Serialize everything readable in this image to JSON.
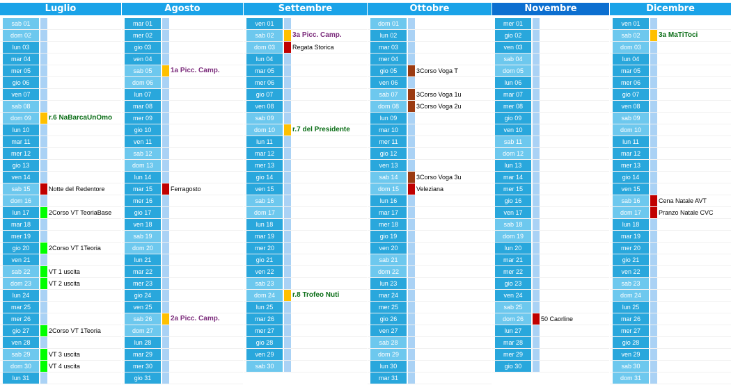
{
  "colors": {
    "header": "#1aa3e8",
    "header_dark": "#0c6fd0",
    "weekday": "#29a7dc",
    "weekend": "#6dc8ee",
    "marker": "#aad2f5",
    "yellow": "#ffc000",
    "red": "#c00000",
    "brown": "#9b3b12",
    "green": "#00ff00"
  },
  "months": [
    {
      "name": "Luglio",
      "header": "light",
      "days": [
        {
          "d": "sab 01",
          "w": true
        },
        {
          "d": "dom 02",
          "w": true
        },
        {
          "d": "lun 03"
        },
        {
          "d": "mar 04"
        },
        {
          "d": "mer 05"
        },
        {
          "d": "gio 06"
        },
        {
          "d": "ven 07"
        },
        {
          "d": "sab 08",
          "w": true
        },
        {
          "d": "dom 09",
          "w": true,
          "mk": "yellow",
          "ev": "r.6 NaBarcaUnOmo",
          "st": "bold"
        },
        {
          "d": "lun 10"
        },
        {
          "d": "mar 11"
        },
        {
          "d": "mer 12"
        },
        {
          "d": "gio 13"
        },
        {
          "d": "ven 14"
        },
        {
          "d": "sab 15",
          "w": true,
          "mk": "red",
          "ev": "Notte del Redentore",
          "st": "normal"
        },
        {
          "d": "dom 16",
          "w": true
        },
        {
          "d": "lun 17",
          "mk": "green",
          "ev": "2Corso VT TeoriaBase",
          "st": "normal"
        },
        {
          "d": "mar 18"
        },
        {
          "d": "mer 19"
        },
        {
          "d": "gio 20",
          "mk": "green",
          "ev": "2Corso VT 1Teoria",
          "st": "normal"
        },
        {
          "d": "ven 21"
        },
        {
          "d": "sab 22",
          "w": true,
          "mk": "green",
          "ev": "VT 1 uscita",
          "st": "normal"
        },
        {
          "d": "dom 23",
          "w": true,
          "mk": "green",
          "ev": "VT 2 uscita",
          "st": "normal"
        },
        {
          "d": "lun 24"
        },
        {
          "d": "mar 25"
        },
        {
          "d": "mer 26"
        },
        {
          "d": "gio 27",
          "mk": "green",
          "ev": "2Corso VT 1Teoria",
          "st": "normal"
        },
        {
          "d": "ven 28"
        },
        {
          "d": "sab 29",
          "w": true,
          "mk": "green",
          "ev": "VT 3 uscita",
          "st": "normal"
        },
        {
          "d": "dom 30",
          "w": true,
          "mk": "green",
          "ev": "VT 4 uscita",
          "st": "normal"
        },
        {
          "d": "lun 31"
        }
      ]
    },
    {
      "name": "Agosto",
      "header": "light",
      "days": [
        {
          "d": "mar 01"
        },
        {
          "d": "mer 02"
        },
        {
          "d": "gio 03"
        },
        {
          "d": "ven 04"
        },
        {
          "d": "sab 05",
          "w": true,
          "mk": "yellow",
          "ev": "1a Picc. Camp.",
          "st": "purple"
        },
        {
          "d": "dom 06",
          "w": true
        },
        {
          "d": "lun 07"
        },
        {
          "d": "mar 08"
        },
        {
          "d": "mer 09"
        },
        {
          "d": "gio 10"
        },
        {
          "d": "ven 11"
        },
        {
          "d": "sab 12",
          "w": true
        },
        {
          "d": "dom 13",
          "w": true
        },
        {
          "d": "lun 14"
        },
        {
          "d": "mar 15",
          "mk": "red",
          "ev": "Ferragosto",
          "st": "normal"
        },
        {
          "d": "mer 16"
        },
        {
          "d": "gio 17"
        },
        {
          "d": "ven 18"
        },
        {
          "d": "sab 19",
          "w": true
        },
        {
          "d": "dom 20",
          "w": true
        },
        {
          "d": "lun 21"
        },
        {
          "d": "mar 22"
        },
        {
          "d": "mer 23"
        },
        {
          "d": "gio 24"
        },
        {
          "d": "ven 25"
        },
        {
          "d": "sab 26",
          "w": true,
          "mk": "yellow",
          "ev": "2a Picc. Camp.",
          "st": "purple"
        },
        {
          "d": "dom 27",
          "w": true
        },
        {
          "d": "lun 28"
        },
        {
          "d": "mar 29"
        },
        {
          "d": "mer 30"
        },
        {
          "d": "gio 31"
        }
      ]
    },
    {
      "name": "Settembre",
      "header": "light",
      "days": [
        {
          "d": "ven 01"
        },
        {
          "d": "sab 02",
          "w": true,
          "mk": "yellow",
          "ev": "3a Picc. Camp.",
          "st": "purple"
        },
        {
          "d": "dom 03",
          "w": true,
          "mk": "red",
          "ev": "Regata Storica",
          "st": "normal"
        },
        {
          "d": "lun 04"
        },
        {
          "d": "mar 05"
        },
        {
          "d": "mer 06"
        },
        {
          "d": "gio 07"
        },
        {
          "d": "ven 08"
        },
        {
          "d": "sab 09",
          "w": true
        },
        {
          "d": "dom 10",
          "w": true,
          "mk": "yellow",
          "ev": "r.7 del Presidente",
          "st": "bold"
        },
        {
          "d": "lun 11"
        },
        {
          "d": "mar 12"
        },
        {
          "d": "mer 13"
        },
        {
          "d": "gio 14"
        },
        {
          "d": "ven 15"
        },
        {
          "d": "sab 16",
          "w": true
        },
        {
          "d": "dom 17",
          "w": true
        },
        {
          "d": "lun 18"
        },
        {
          "d": "mar 19"
        },
        {
          "d": "mer 20"
        },
        {
          "d": "gio 21"
        },
        {
          "d": "ven 22"
        },
        {
          "d": "sab 23",
          "w": true
        },
        {
          "d": "dom 24",
          "w": true,
          "mk": "yellow",
          "ev": "r.8 Trofeo Nuti",
          "st": "bold"
        },
        {
          "d": "lun 25"
        },
        {
          "d": "mar 26"
        },
        {
          "d": "mer 27"
        },
        {
          "d": "gio 28"
        },
        {
          "d": "ven 29"
        },
        {
          "d": "sab 30",
          "w": true
        }
      ]
    },
    {
      "name": "Ottobre",
      "header": "light",
      "days": [
        {
          "d": "dom 01",
          "w": true
        },
        {
          "d": "lun 02"
        },
        {
          "d": "mar 03"
        },
        {
          "d": "mer 04"
        },
        {
          "d": "gio 05",
          "mk": "brown",
          "ev": "3Corso Voga T",
          "st": "normal"
        },
        {
          "d": "ven 06"
        },
        {
          "d": "sab 07",
          "w": true,
          "mk": "brown",
          "ev": "3Corso Voga 1u",
          "st": "normal"
        },
        {
          "d": "dom 08",
          "w": true,
          "mk": "brown",
          "ev": "3Corso Voga 2u",
          "st": "normal"
        },
        {
          "d": "lun 09"
        },
        {
          "d": "mar 10"
        },
        {
          "d": "mer 11"
        },
        {
          "d": "gio 12"
        },
        {
          "d": "ven 13"
        },
        {
          "d": "sab 14",
          "w": true,
          "mk": "brown",
          "ev": "3Corso Voga 3u",
          "st": "normal"
        },
        {
          "d": "dom 15",
          "w": true,
          "mk": "red",
          "ev": "Veleziana",
          "st": "normal"
        },
        {
          "d": "lun 16"
        },
        {
          "d": "mar 17"
        },
        {
          "d": "mer 18"
        },
        {
          "d": "gio 19"
        },
        {
          "d": "ven 20"
        },
        {
          "d": "sab 21",
          "w": true
        },
        {
          "d": "dom 22",
          "w": true
        },
        {
          "d": "lun 23"
        },
        {
          "d": "mar 24"
        },
        {
          "d": "mer 25"
        },
        {
          "d": "gio 26"
        },
        {
          "d": "ven 27"
        },
        {
          "d": "sab 28",
          "w": true
        },
        {
          "d": "dom 29",
          "w": true
        },
        {
          "d": "lun 30"
        },
        {
          "d": "mar 31"
        }
      ]
    },
    {
      "name": "Novembre",
      "header": "dark",
      "days": [
        {
          "d": "mer 01"
        },
        {
          "d": "gio 02"
        },
        {
          "d": "ven 03"
        },
        {
          "d": "sab 04",
          "w": true
        },
        {
          "d": "dom 05",
          "w": true
        },
        {
          "d": "lun 06"
        },
        {
          "d": "mar 07"
        },
        {
          "d": "mer 08"
        },
        {
          "d": "gio 09"
        },
        {
          "d": "ven 10"
        },
        {
          "d": "sab 11",
          "w": true
        },
        {
          "d": "dom 12",
          "w": true
        },
        {
          "d": "lun 13"
        },
        {
          "d": "mar 14"
        },
        {
          "d": "mer 15"
        },
        {
          "d": "gio 16"
        },
        {
          "d": "ven 17"
        },
        {
          "d": "sab 18",
          "w": true
        },
        {
          "d": "dom 19",
          "w": true
        },
        {
          "d": "lun 20"
        },
        {
          "d": "mar 21"
        },
        {
          "d": "mer 22"
        },
        {
          "d": "gio 23"
        },
        {
          "d": "ven 24"
        },
        {
          "d": "sab 25",
          "w": true
        },
        {
          "d": "dom 26",
          "w": true,
          "mk": "red",
          "ev": "50 Caorline",
          "st": "normal"
        },
        {
          "d": "lun 27"
        },
        {
          "d": "mar 28"
        },
        {
          "d": "mer 29"
        },
        {
          "d": "gio 30"
        }
      ]
    },
    {
      "name": "Dicembre",
      "header": "light",
      "days": [
        {
          "d": "ven 01"
        },
        {
          "d": "sab 02",
          "w": true,
          "mk": "yellow",
          "ev": "3a MaTiToci",
          "st": "bold"
        },
        {
          "d": "dom 03",
          "w": true
        },
        {
          "d": "lun 04"
        },
        {
          "d": "mar 05"
        },
        {
          "d": "mer 06"
        },
        {
          "d": "gio 07"
        },
        {
          "d": "ven 08"
        },
        {
          "d": "sab 09",
          "w": true
        },
        {
          "d": "dom 10",
          "w": true
        },
        {
          "d": "lun 11"
        },
        {
          "d": "mar 12"
        },
        {
          "d": "mer 13"
        },
        {
          "d": "gio 14"
        },
        {
          "d": "ven 15"
        },
        {
          "d": "sab 16",
          "w": true,
          "mk": "red",
          "ev": "Cena Natale AVT",
          "st": "normal"
        },
        {
          "d": "dom 17",
          "w": true,
          "mk": "red",
          "ev": "Pranzo Natale CVC",
          "st": "normal"
        },
        {
          "d": "lun 18"
        },
        {
          "d": "mar 19"
        },
        {
          "d": "mer 20"
        },
        {
          "d": "gio 21"
        },
        {
          "d": "ven 22"
        },
        {
          "d": "sab 23",
          "w": true
        },
        {
          "d": "dom 24",
          "w": true
        },
        {
          "d": "lun 25"
        },
        {
          "d": "mar 26"
        },
        {
          "d": "mer 27"
        },
        {
          "d": "gio 28"
        },
        {
          "d": "ven 29"
        },
        {
          "d": "sab 30",
          "w": true
        },
        {
          "d": "dom 31",
          "w": true
        }
      ]
    }
  ]
}
